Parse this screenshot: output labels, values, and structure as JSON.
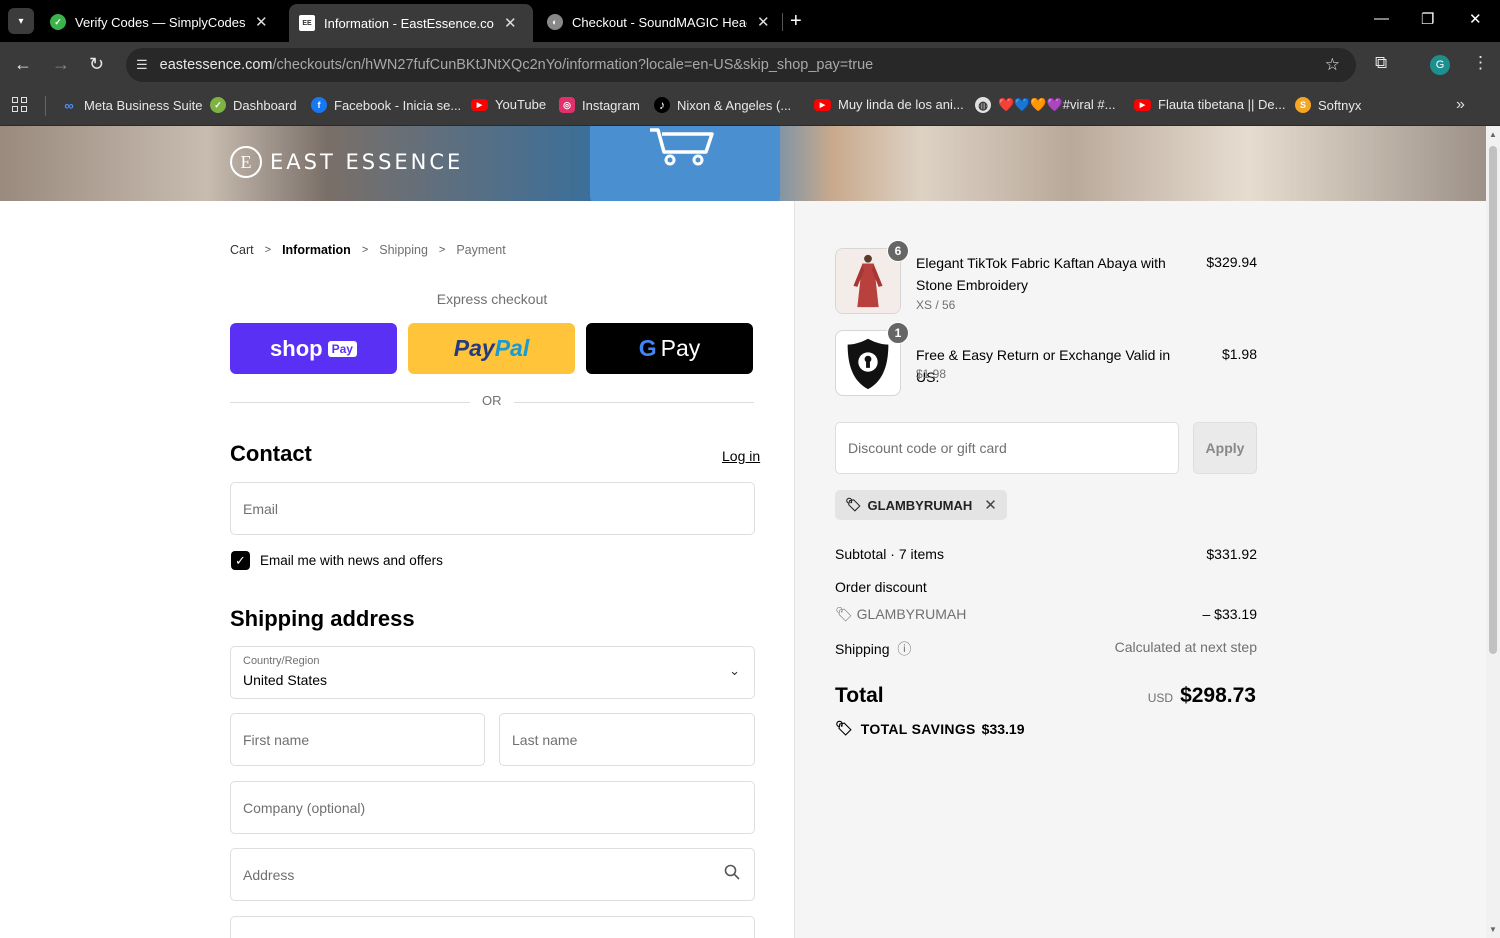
{
  "browser": {
    "tabs": [
      {
        "title": "Verify Codes — SimplyCodes",
        "active": false,
        "favicon_color": "#3bb24a"
      },
      {
        "title": "Information - EastEssence.com",
        "active": true,
        "favicon_color": "#ffffff"
      },
      {
        "title": "Checkout - SoundMAGIC Headp",
        "active": false,
        "favicon_color": "#888888"
      }
    ],
    "url_host": "eastessence.com",
    "url_path": "/checkouts/cn/hWN27fufCunBKtJNtXQc2nYo/information?locale=en-US&skip_shop_pay=true",
    "profile_initial": "G",
    "bookmarks": [
      {
        "label": "Meta Business Suite",
        "icon": "meta-icon",
        "color": "#1877f2"
      },
      {
        "label": "Dashboard",
        "icon": "dashboard-icon",
        "color": "#7cb342"
      },
      {
        "label": "Facebook - Inicia se...",
        "icon": "facebook-icon",
        "color": "#1877f2"
      },
      {
        "label": "YouTube",
        "icon": "youtube-icon",
        "color": "#ff0000"
      },
      {
        "label": "Instagram",
        "icon": "instagram-icon",
        "color": "#e1306c"
      },
      {
        "label": "Nixon & Angeles (...",
        "icon": "tiktok-icon",
        "color": "#000000"
      },
      {
        "label": "Muy linda de los ani...",
        "icon": "youtube-icon",
        "color": "#ff0000"
      },
      {
        "label": "❤️💙🧡💜#viral #...",
        "icon": "globe-icon",
        "color": "#e0e0e0"
      },
      {
        "label": "Flauta tibetana || De...",
        "icon": "youtube-icon",
        "color": "#ff0000"
      },
      {
        "label": "Softnyx",
        "icon": "softnyx-icon",
        "color": "#f5a623"
      }
    ]
  },
  "store": {
    "logo_text": "EAST ESSENCE",
    "logo_mark": "E"
  },
  "breadcrumb": {
    "cart": "Cart",
    "information": "Information",
    "shipping": "Shipping",
    "payment": "Payment"
  },
  "express": {
    "label": "Express checkout",
    "shop": "shop",
    "shop_pay": "Pay",
    "paypal_1": "Pay",
    "paypal_2": "Pal",
    "gpay_g": "G",
    "gpay": "Pay",
    "or": "OR"
  },
  "contact": {
    "heading": "Contact",
    "login": "Log in",
    "email_placeholder": "Email",
    "newsletter_label": "Email me with news and offers",
    "newsletter_checked": true
  },
  "shipping": {
    "heading": "Shipping address",
    "country_label": "Country/Region",
    "country_value": "United States",
    "first_name": "First name",
    "last_name": "Last name",
    "company": "Company (optional)",
    "address": "Address"
  },
  "summary": {
    "items": [
      {
        "name": "Elegant TikTok Fabric Kaftan Abaya with Stone Embroidery",
        "variant": "XS / 56",
        "price": "$329.94",
        "quantity": "6"
      },
      {
        "name": "Free & Easy Return or Exchange Valid in US.",
        "variant": "$1.98",
        "price": "$1.98",
        "quantity": "1"
      }
    ],
    "discount_placeholder": "Discount code or gift card",
    "apply": "Apply",
    "applied_code": "GLAMBYRUMAH",
    "subtotal_label": "Subtotal · 7 items",
    "subtotal": "$331.92",
    "order_discount_label": "Order discount",
    "discount_code": "GLAMBYRUMAH",
    "discount_amount": "– $33.19",
    "shipping_label": "Shipping",
    "shipping_value": "Calculated at next step",
    "total_label": "Total",
    "currency": "USD",
    "total": "$298.73",
    "savings_label": "TOTAL SAVINGS",
    "savings": "$33.19"
  }
}
